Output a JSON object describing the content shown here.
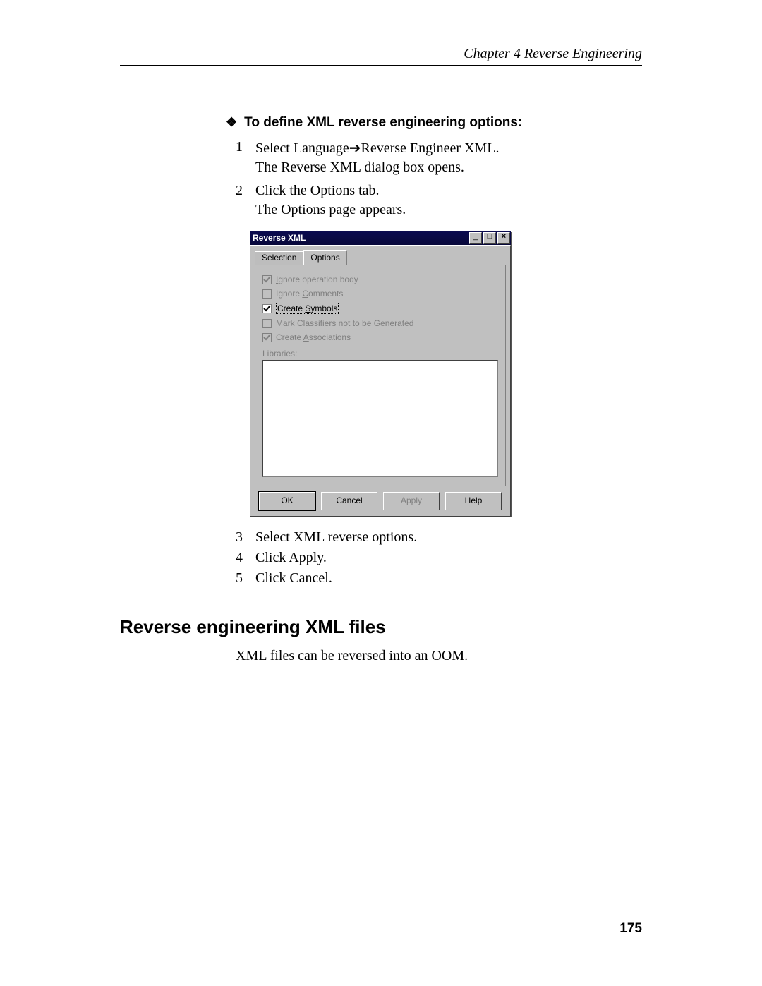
{
  "header": "Chapter 4  Reverse Engineering",
  "lead": "To define XML reverse engineering options:",
  "steps": {
    "s1n": "1",
    "s1a": "Select Language➔Reverse Engineer XML.",
    "s1b": "The Reverse XML dialog box opens.",
    "s2n": "2",
    "s2a": "Click the Options tab.",
    "s2b": "The Options page appears.",
    "s3n": "3",
    "s3a": "Select XML reverse options.",
    "s4n": "4",
    "s4a": "Click Apply.",
    "s5n": "5",
    "s5a": "Click Cancel."
  },
  "dialog": {
    "title": "Reverse XML",
    "tabSelection": "Selection",
    "tabOptions": "Options",
    "opts": {
      "o1p": "I",
      "o1s": "gnore operation body",
      "o2p": "Ignore ",
      "o2u": "C",
      "o2s": "omments",
      "o3p": "Create ",
      "o3u": "S",
      "o3s": "ymbols",
      "o4p": "",
      "o4u": "M",
      "o4s": "ark Classifiers not to be Generated",
      "o5p": "Create ",
      "o5u": "A",
      "o5s": "ssociations"
    },
    "librariesLabel": "Libraries:",
    "btnOK": "OK",
    "btnCancel": "Cancel",
    "btnApply": "Apply",
    "btnHelp": "Help"
  },
  "sectionTitle": "Reverse engineering XML files",
  "sectionPara": "XML files can be reversed into an OOM.",
  "pageNumber": "175"
}
